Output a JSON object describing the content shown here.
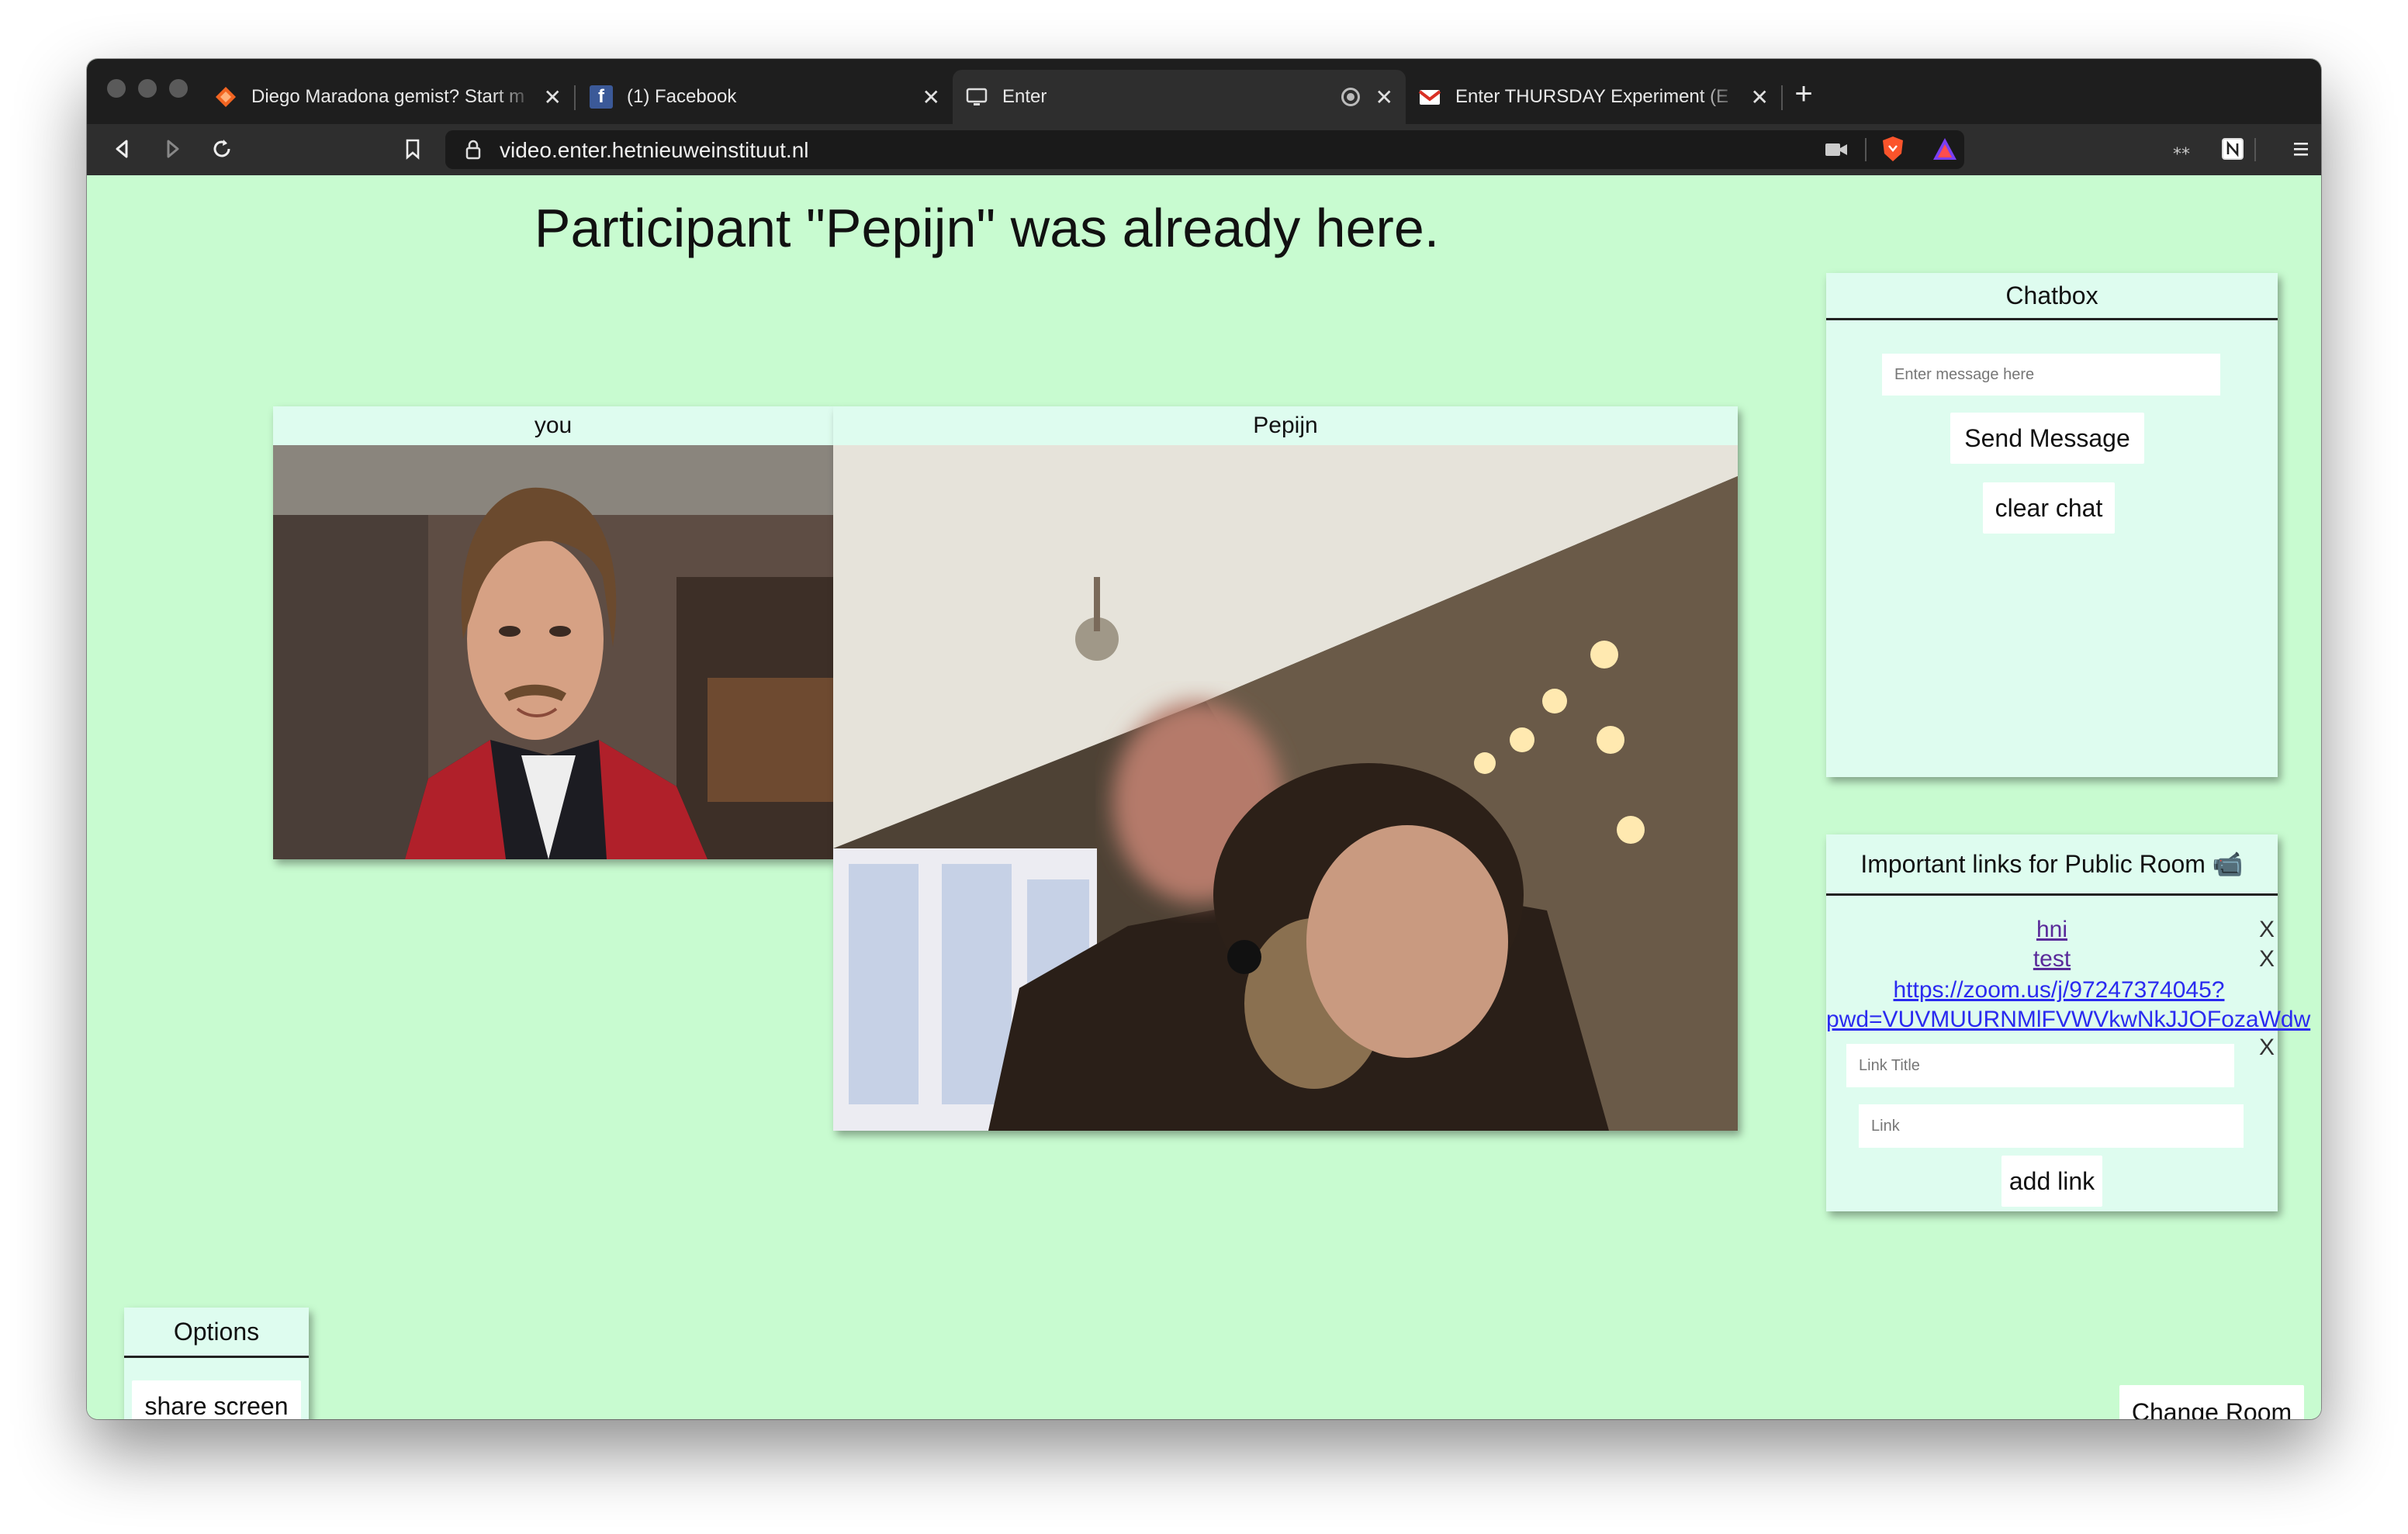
{
  "browser": {
    "tabs": [
      {
        "title": "Diego Maradona gemist? Start m",
        "favicon": "diamond-orange-icon"
      },
      {
        "title": "(1) Facebook",
        "favicon": "facebook-icon"
      },
      {
        "title": "Enter",
        "favicon": "monitor-icon"
      },
      {
        "title": "Enter THURSDAY Experiment (E",
        "favicon": "gmail-icon"
      }
    ],
    "url": "video.enter.hetnieuweinstituut.nl"
  },
  "page": {
    "heading": "Participant \"Pepijn\" was already here."
  },
  "videos": {
    "self_label": "you",
    "peer_label": "Pepijn"
  },
  "chatbox": {
    "title": "Chatbox",
    "placeholder": "Enter message here",
    "send_label": "Send Message",
    "clear_label": "clear chat"
  },
  "links_panel": {
    "title": "Important links for Public Room 📹",
    "links": [
      {
        "text": "hni"
      },
      {
        "text": "test"
      },
      {
        "text": "https://zoom.us/j/97247374045?\npwd=VUVMUURNMlFVWVkwNkJJOFozaWdw"
      }
    ],
    "remove_label": "X",
    "title_placeholder": "Link Title",
    "link_placeholder": "Link",
    "add_label": "add link"
  },
  "options": {
    "title": "Options",
    "share_label": "share screen"
  },
  "change_room_label": "Change Room",
  "colors": {
    "page_bg": "#c8fbd0",
    "panel_bg": "#defcef",
    "browser_chrome": "#2e2e2e"
  }
}
